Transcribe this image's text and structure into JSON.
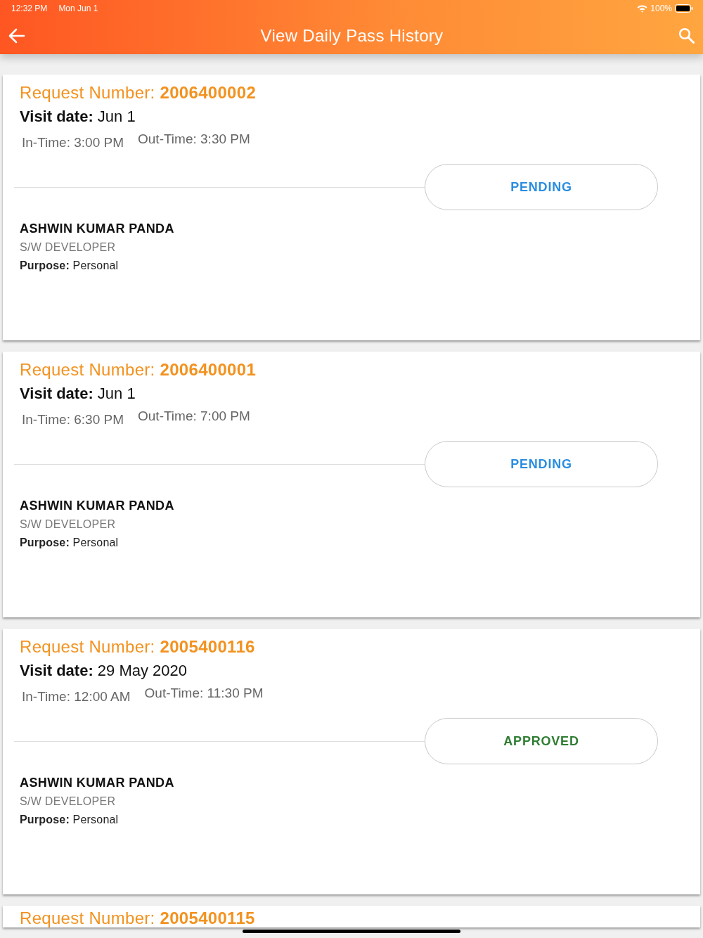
{
  "status_bar": {
    "time": "12:32 PM",
    "date": "Mon Jun 1",
    "battery": "100%"
  },
  "app_bar": {
    "title": "View Daily Pass History"
  },
  "requests": [
    {
      "request": "Request Number: **2006400002**",
      "visit_date": "**Visit date:** Jun 1",
      "in_time": "In-Time: 3:00 PM",
      "out_time": "Out-Time: 3:30 PM",
      "status": {
        "label": "PENDING",
        "color": "#2a8de0"
      },
      "name": "ASHWIN KUMAR PANDA",
      "designation": "S/W DEVELOPER",
      "purpose": "**Purpose:** Personal"
    },
    {
      "request": "Request Number: **2006400001**",
      "visit_date": "**Visit date:** Jun 1",
      "in_time": "In-Time: 6:30 PM",
      "out_time": "Out-Time: 7:00 PM",
      "status": {
        "label": "PENDING",
        "color": "#2a8de0"
      },
      "name": "ASHWIN KUMAR PANDA",
      "designation": "S/W DEVELOPER",
      "purpose": "**Purpose:** Personal"
    },
    {
      "request": "Request Number: **2005400116**",
      "visit_date": "**Visit date:** 29 May 2020",
      "in_time": "In-Time: 12:00 AM",
      "out_time": "Out-Time: 11:30 PM",
      "status": {
        "label": "APPROVED",
        "color": "#2e7d32"
      },
      "name": "ASHWIN KUMAR PANDA",
      "designation": "S/W DEVELOPER",
      "purpose": "**Purpose:** Personal"
    },
    {
      "request": "Request Number: **2005400115**"
    }
  ]
}
